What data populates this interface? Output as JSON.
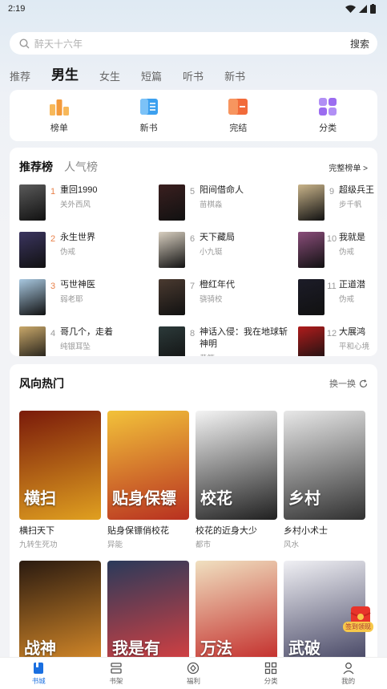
{
  "status": {
    "time": "2:19"
  },
  "search": {
    "placeholder": "醉天十六年",
    "button": "搜索"
  },
  "top_tabs": [
    "推荐",
    "男生",
    "女生",
    "短篇",
    "听书",
    "新书"
  ],
  "categories": [
    {
      "label": "榜单",
      "icon": "trophy-icon",
      "color": "#f39a3c"
    },
    {
      "label": "新书",
      "icon": "new-book-icon",
      "color": "#3ca0ef"
    },
    {
      "label": "完结",
      "icon": "finished-icon",
      "color": "#f26b3a"
    },
    {
      "label": "分类",
      "icon": "category-grid-icon",
      "color": "#9b6cf0"
    }
  ],
  "ranking": {
    "tabs": [
      "推荐榜",
      "人气榜"
    ],
    "more": "完整榜单 >",
    "items": [
      {
        "num": "1",
        "title": "重回1990",
        "author": "关外西风",
        "color": "#5a5a5a"
      },
      {
        "num": "5",
        "title": "阳间借命人",
        "author": "苗棋淼",
        "color": "#3a1f1f"
      },
      {
        "num": "9",
        "title": "超级兵王",
        "author": "步千帆",
        "color": "#c9b48a"
      },
      {
        "num": "2",
        "title": "永生世界",
        "author": "伪戒",
        "color": "#3b3560"
      },
      {
        "num": "6",
        "title": "天下藏局",
        "author": "小九铤",
        "color": "#d8cfc0"
      },
      {
        "num": "10",
        "title": "我就是",
        "author": "伪戒",
        "color": "#8a4d7a"
      },
      {
        "num": "3",
        "title": "丐世神医",
        "author": "弱老耶",
        "color": "#a8c8e0"
      },
      {
        "num": "7",
        "title": "橙红年代",
        "author": "骁骑校",
        "color": "#4a3a30"
      },
      {
        "num": "11",
        "title": "正道潜",
        "author": "伪戒",
        "color": "#1c1c28"
      },
      {
        "num": "4",
        "title": "哥几个，走着",
        "author": "纯银耳坠",
        "color": "#c9a86a"
      },
      {
        "num": "8",
        "title": "神话入侵：我在地球斩神明",
        "author": "黄笔",
        "color": "#2c3a3a"
      },
      {
        "num": "12",
        "title": "大展鸿",
        "author": "平和心境",
        "color": "#b01c1c"
      }
    ]
  },
  "hot": {
    "title": "风向热门",
    "refresh": "换一换",
    "books": [
      {
        "name": "横扫天下",
        "sub": "九转生死功",
        "color1": "#7a1a0a",
        "color2": "#e0a020",
        "cover_text": "横扫"
      },
      {
        "name": "贴身保镖俏校花",
        "sub": "异能",
        "color1": "#f2c23a",
        "color2": "#b83020",
        "cover_text": "贴身保镖"
      },
      {
        "name": "校花的近身大少",
        "sub": "都市",
        "color1": "#f4f4f4",
        "color2": "#202020",
        "cover_text": "校花"
      },
      {
        "name": "乡村小术士",
        "sub": "风水",
        "color1": "#e8e8e8",
        "color2": "#303030",
        "cover_text": "乡村"
      },
      {
        "name": "",
        "sub": "",
        "color1": "#2a1a10",
        "color2": "#e0902a",
        "cover_text": "战神"
      },
      {
        "name": "",
        "sub": "",
        "color1": "#2a3a5a",
        "color2": "#e04040",
        "cover_text": "我是有"
      },
      {
        "name": "",
        "sub": "",
        "color1": "#f0e0c0",
        "color2": "#c02020",
        "cover_text": "万法"
      },
      {
        "name": "",
        "sub": "",
        "color1": "#f0f0f4",
        "color2": "#3a3a5a",
        "cover_text": "武破"
      }
    ]
  },
  "redpack": {
    "label": "签到领现"
  },
  "bottom_nav": [
    {
      "label": "书城",
      "icon": "bookstore-icon"
    },
    {
      "label": "书架",
      "icon": "bookshelf-icon"
    },
    {
      "label": "福利",
      "icon": "welfare-icon"
    },
    {
      "label": "分类",
      "icon": "category-icon"
    },
    {
      "label": "我的",
      "icon": "profile-icon"
    }
  ]
}
